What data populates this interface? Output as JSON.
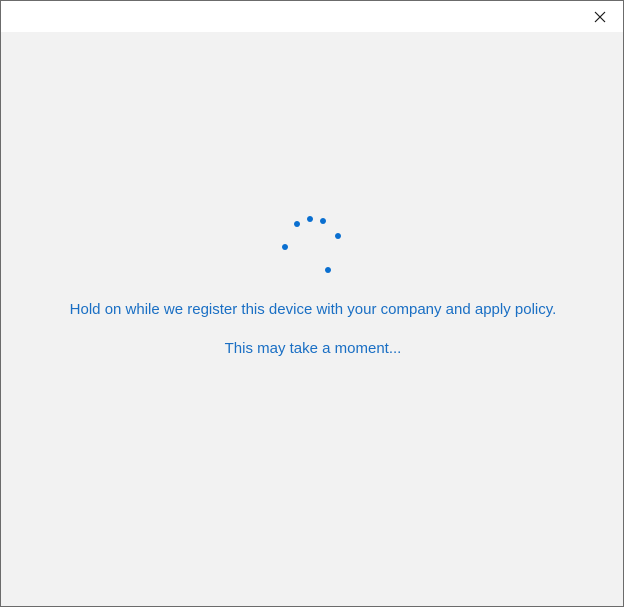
{
  "window": {
    "close_icon": "close-icon"
  },
  "spinner": {
    "icon": "loading-spinner-icon",
    "color": "#0a6fd0"
  },
  "messages": {
    "primary": "Hold on while we register this device with your company and apply policy.",
    "secondary": "This may take a moment..."
  },
  "colors": {
    "text": "#1a6fc4",
    "background": "#f2f2f2",
    "titlebar": "#ffffff"
  }
}
